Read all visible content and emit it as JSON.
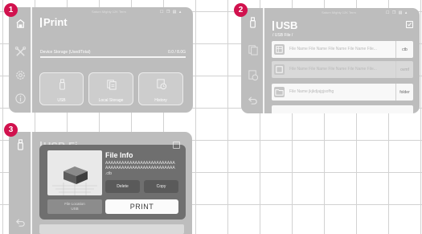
{
  "badges": [
    "1",
    "2",
    "3"
  ],
  "status": {
    "device_name": "Saturn Mighty 12K Term",
    "icons": "☐ ❐ ▤ ▴"
  },
  "screen1": {
    "title": "Print",
    "storage": {
      "label": "Device Storage (Used/Total)",
      "value": "0.0 / 8.0G",
      "used_fraction": 0.0
    },
    "cards": [
      {
        "label": "USB",
        "icon": "usb-drive-icon"
      },
      {
        "label": "Local Storage",
        "icon": "documents-icon"
      },
      {
        "label": "History",
        "icon": "history-icon"
      }
    ],
    "rail_icons": [
      "print-home-icon",
      "tools-icon",
      "settings-icon",
      "info-icon"
    ]
  },
  "screen2": {
    "title": "USB",
    "breadcrumb": "/ USB File /",
    "rows": [
      {
        "name": "File Name File Name File Name File Name File...",
        "type": "ctb",
        "icon": "model-file-icon",
        "dim": false
      },
      {
        "name": "File Name File Name File Name File Name File...",
        "type": "ovmf",
        "icon": "model-file-icon",
        "dim": true
      },
      {
        "name": "File Name jkjkdjajgjsofhg",
        "type": "folder",
        "icon": "folder-icon",
        "dim": false
      }
    ],
    "rail_icons": [
      "usb-drive-icon",
      "documents-icon",
      "history-icon",
      "back-icon"
    ]
  },
  "screen3": {
    "title_fragment": "USB Fi...",
    "rail_icons": [
      "usb-drive-icon",
      "back-icon"
    ],
    "popup": {
      "title": "File Info",
      "file_name": "AAAAAAAAAAAAAAAAAAAAAAAAAAAAAAAAAAAAAAAAAAAAAAAAAAAAA",
      "extension": ".ctb",
      "delete_label": "Delete",
      "copy_label": "Copy",
      "location_label": "File Location",
      "location_value": "USB",
      "print_label": "PRINT"
    }
  },
  "colors": {
    "badge": "#d1124e",
    "screen": "#bdbdbd",
    "popup": "#6f6f6f",
    "grid": "#d2d2d2"
  }
}
